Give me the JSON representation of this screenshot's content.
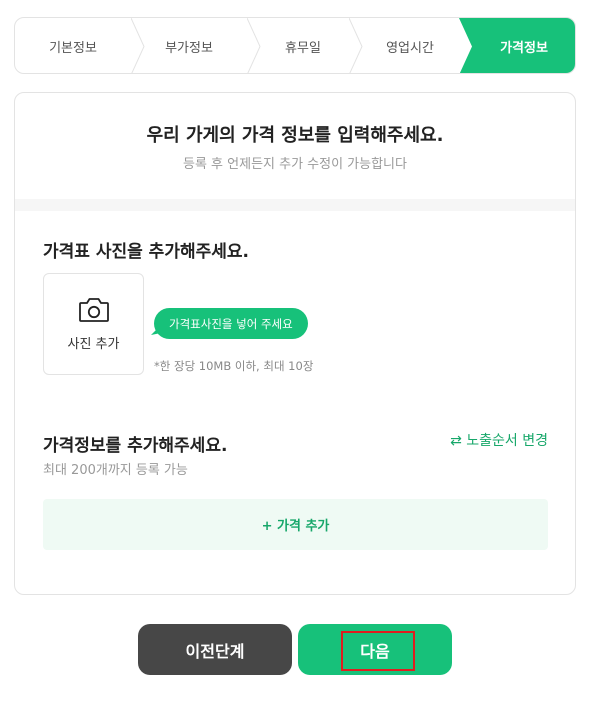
{
  "stepper": {
    "steps": [
      {
        "label": "기본정보"
      },
      {
        "label": "부가정보"
      },
      {
        "label": "휴무일"
      },
      {
        "label": "영업시간"
      },
      {
        "label": "가격정보"
      }
    ],
    "active_color": "#17c17a"
  },
  "card": {
    "title": "우리 가게의 가격 정보를 입력해주세요.",
    "subtitle": "등록 후 언제든지 추가 수정이 가능합니다"
  },
  "photo_section": {
    "title": "가격표 사진을 추가해주세요.",
    "add_label": "사진 추가",
    "bubble_text": "가격표사진을 넣어 주세요",
    "note": "*한 장당 10MB 이하, 최대 10장",
    "icon": "camera-icon"
  },
  "price_section": {
    "title": "가격정보를 추가해주세요.",
    "limit_text": "최대 200개까지 등록 가능",
    "reorder_label": "⇄ 노출순서 변경",
    "add_label": "+ 가격 추가"
  },
  "buttons": {
    "prev_label": "이전단계",
    "next_label": "다음"
  },
  "colors": {
    "brand": "#17c17a",
    "dark_button": "#474747",
    "highlight": "#e01e1e"
  }
}
